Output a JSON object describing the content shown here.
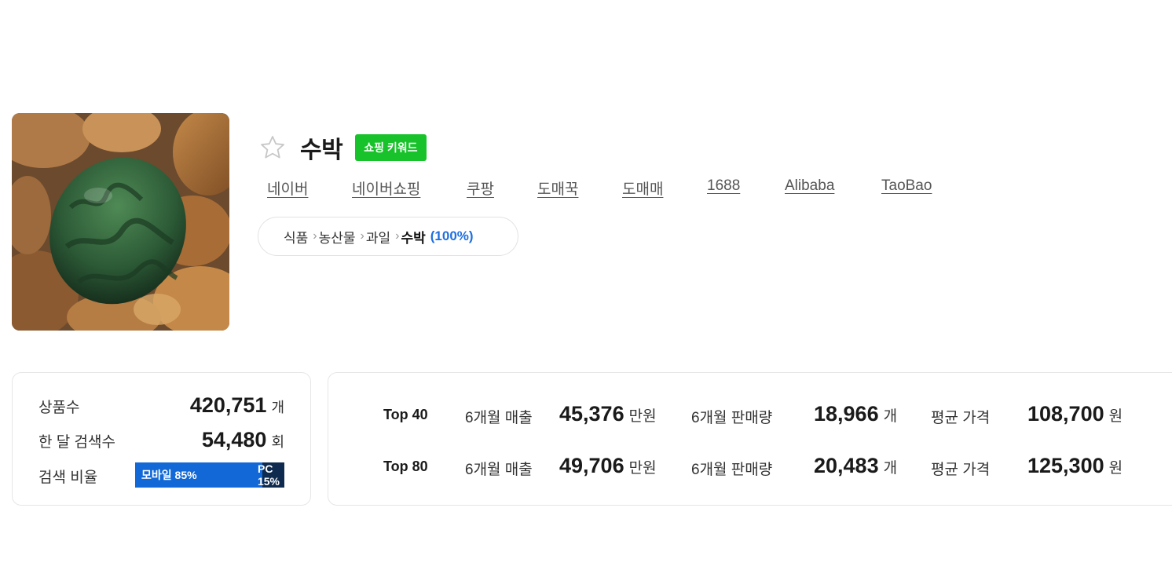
{
  "keyword": {
    "title": "수박",
    "badge": "쇼핑 키워드"
  },
  "links": [
    "네이버",
    "네이버쇼핑",
    "쿠팡",
    "도매꾹",
    "도매매",
    "1688",
    "Alibaba",
    "TaoBao"
  ],
  "category": {
    "path": [
      "식품",
      "농산물",
      "과일"
    ],
    "current": "수박",
    "percent": "(100%)"
  },
  "stats": {
    "products_label": "상품수",
    "products_value": "420,751",
    "products_unit": "개",
    "searches_label": "한 달 검색수",
    "searches_value": "54,480",
    "searches_unit": "회",
    "ratio_label": "검색 비율",
    "mobile_label": "모바일 85%",
    "pc_label": "PC 15%",
    "mobile_ratio": 0.85
  },
  "top": [
    {
      "label": "Top 40",
      "sales_label": "6개월 매출",
      "sales_value": "45,376",
      "sales_unit": "만원",
      "volume_label": "6개월 판매량",
      "volume_value": "18,966",
      "volume_unit": "개",
      "price_label": "평균 가격",
      "price_value": "108,700",
      "price_unit": "원"
    },
    {
      "label": "Top 80",
      "sales_label": "6개월 매출",
      "sales_value": "49,706",
      "sales_unit": "만원",
      "volume_label": "6개월 판매량",
      "volume_value": "20,483",
      "volume_unit": "개",
      "price_label": "평균 가격",
      "price_value": "125,300",
      "price_unit": "원"
    }
  ],
  "colors": {
    "badge": "#18c22a",
    "mobile": "#1268d6",
    "pc": "#0e2a4e",
    "percent": "#1f6fe0"
  }
}
